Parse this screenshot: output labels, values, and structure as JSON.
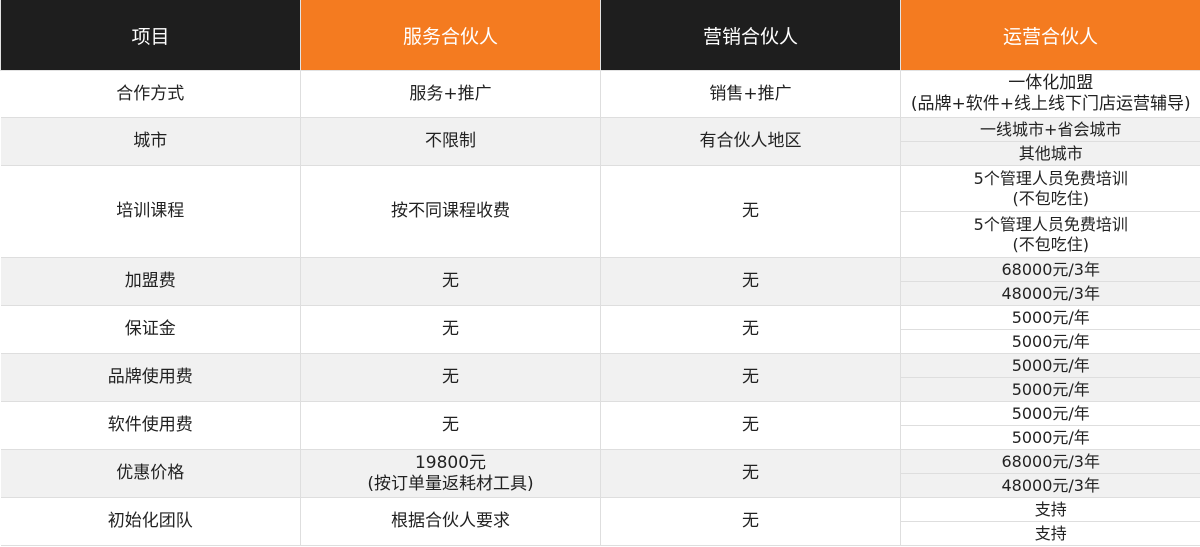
{
  "header": {
    "item": "项目",
    "service": "服务合伙人",
    "marketing": "营销合伙人",
    "operation": "运营合伙人"
  },
  "rows": {
    "coop": {
      "label": "合作方式",
      "service": "服务+推广",
      "marketing": "销售+推广",
      "operation_line1": "一体化加盟",
      "operation_line2": "(品牌+软件+线上线下门店运营辅导)"
    },
    "city": {
      "label": "城市",
      "service": "不限制",
      "marketing": "有合伙人地区",
      "operation_a": "一线城市+省会城市",
      "operation_b": "其他城市"
    },
    "training": {
      "label": "培训课程",
      "service": "按不同课程收费",
      "marketing": "无",
      "operation_a_line1": "5个管理人员免费培训",
      "operation_a_line2": "(不包吃住)",
      "operation_b_line1": "5个管理人员免费培训",
      "operation_b_line2": "(不包吃住)"
    },
    "franchise_fee": {
      "label": "加盟费",
      "service": "无",
      "marketing": "无",
      "operation_a": "68000元/3年",
      "operation_b": "48000元/3年"
    },
    "deposit": {
      "label": "保证金",
      "service": "无",
      "marketing": "无",
      "operation_a": "5000元/年",
      "operation_b": "5000元/年"
    },
    "brand_fee": {
      "label": "品牌使用费",
      "service": "无",
      "marketing": "无",
      "operation_a": "5000元/年",
      "operation_b": "5000元/年"
    },
    "software_fee": {
      "label": "软件使用费",
      "service": "无",
      "marketing": "无",
      "operation_a": "5000元/年",
      "operation_b": "5000元/年"
    },
    "discount": {
      "label": "优惠价格",
      "service_line1": "19800元",
      "service_line2": "(按订单量返耗材工具)",
      "marketing": "无",
      "operation_a": "68000元/3年",
      "operation_b": "48000元/3年"
    },
    "team": {
      "label": "初始化团队",
      "service": "根据合伙人要求",
      "marketing": "无",
      "operation_a": "支持",
      "operation_b": "支持"
    }
  },
  "colors": {
    "header_dark": "#1e1e1e",
    "header_orange": "#f47b20",
    "row_stripe": "#f1f1f1"
  }
}
